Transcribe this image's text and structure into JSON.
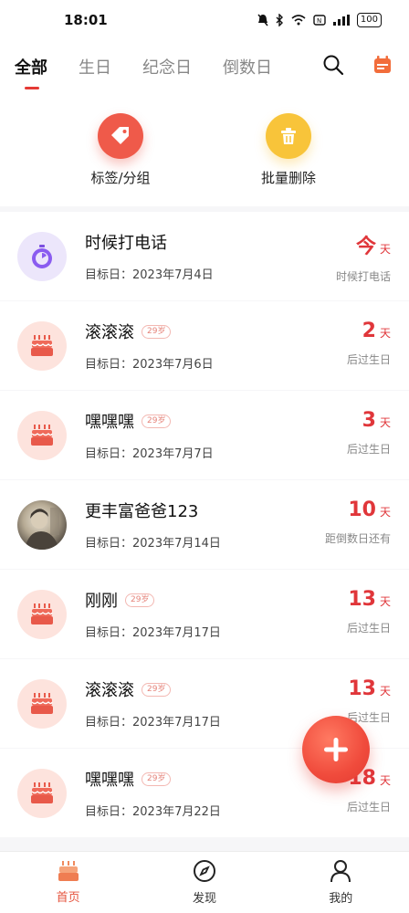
{
  "status_bar": {
    "time": "18:01",
    "battery": "100"
  },
  "tabs": [
    {
      "label": "全部",
      "active": true
    },
    {
      "label": "生日",
      "active": false
    },
    {
      "label": "纪念日",
      "active": false
    },
    {
      "label": "倒数日",
      "active": false
    }
  ],
  "top_icons": [
    "search-icon",
    "calendar-icon"
  ],
  "quick_actions": [
    {
      "label": "标签/分组",
      "icon": "tag-icon",
      "color": "#ef5a4a"
    },
    {
      "label": "批量删除",
      "icon": "trash-icon",
      "color": "#f8c43a"
    }
  ],
  "events": [
    {
      "title": "时候打电话",
      "badge": "",
      "date": "目标日：2023年7月4日",
      "days": "今",
      "unit": "天",
      "note": "时候打电话",
      "icon": "timer-icon"
    },
    {
      "title": "滚滚滚",
      "badge": "29岁",
      "date": "目标日：2023年7月6日",
      "days": "2",
      "unit": "天",
      "note": "后过生日",
      "icon": "cake-icon"
    },
    {
      "title": "嘿嘿嘿",
      "badge": "29岁",
      "date": "目标日：2023年7月7日",
      "days": "3",
      "unit": "天",
      "note": "后过生日",
      "icon": "cake-icon"
    },
    {
      "title": "更丰富爸爸123",
      "badge": "",
      "date": "目标日：2023年7月14日",
      "days": "10",
      "unit": "天",
      "note": "距倒数日还有",
      "icon": "photo-avatar"
    },
    {
      "title": "刚刚",
      "badge": "29岁",
      "date": "目标日：2023年7月17日",
      "days": "13",
      "unit": "天",
      "note": "后过生日",
      "icon": "cake-icon"
    },
    {
      "title": "滚滚滚",
      "badge": "29岁",
      "date": "目标日：2023年7月17日",
      "days": "13",
      "unit": "天",
      "note": "后过生日",
      "icon": "cake-icon"
    },
    {
      "title": "嘿嘿嘿",
      "badge": "29岁",
      "date": "目标日：2023年7月22日",
      "days": "18",
      "unit": "天",
      "note": "后过生日",
      "icon": "cake-icon"
    }
  ],
  "bottom_nav": [
    {
      "label": "首页",
      "icon": "home-cake-icon",
      "active": true
    },
    {
      "label": "发现",
      "icon": "compass-icon",
      "active": false
    },
    {
      "label": "我的",
      "icon": "profile-icon",
      "active": false
    }
  ],
  "colors": {
    "accent": "#e0363a",
    "fab": "#f04b3c"
  }
}
